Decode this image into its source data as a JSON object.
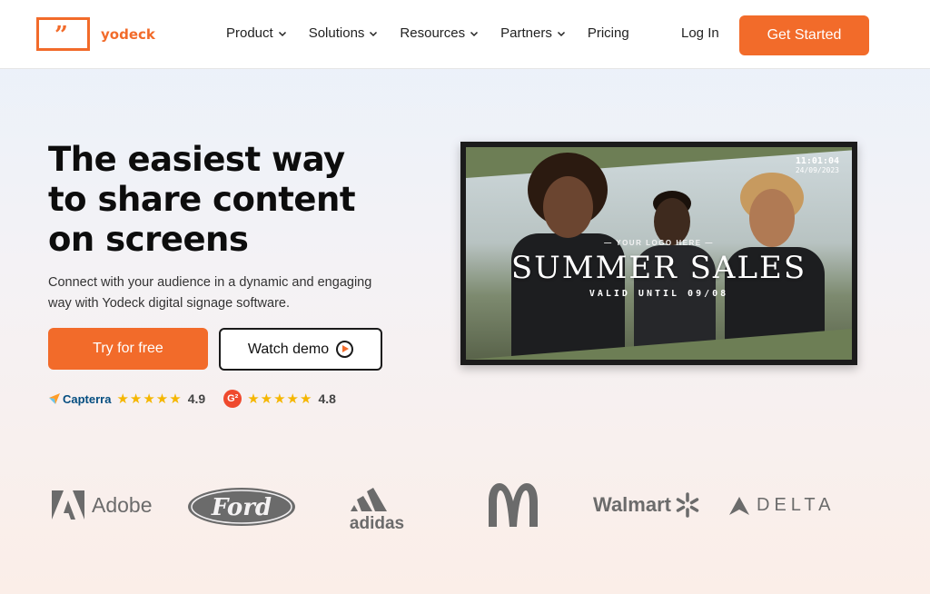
{
  "nav": {
    "logo_text": "yodeck",
    "items": [
      {
        "label": "Product",
        "has_dropdown": true
      },
      {
        "label": "Solutions",
        "has_dropdown": true
      },
      {
        "label": "Resources",
        "has_dropdown": true
      },
      {
        "label": "Partners",
        "has_dropdown": true
      },
      {
        "label": "Pricing",
        "has_dropdown": false
      }
    ],
    "login_label": "Log In",
    "cta_label": "Get Started"
  },
  "hero": {
    "title_lines": [
      "The easiest way",
      "to share content",
      "on screens"
    ],
    "subtitle": "Connect with your audience in a dynamic and engaging way with Yodeck digital signage software.",
    "try_label": "Try for free",
    "demo_label": "Watch demo"
  },
  "ratings": [
    {
      "source": "Capterra",
      "stars": 5,
      "score": "4.9"
    },
    {
      "source": "G2",
      "stars": 5,
      "score": "4.8"
    }
  ],
  "screen": {
    "time": "11:01:04",
    "date": "24/09/2023",
    "logo_placeholder": "YOUR LOGO HERE",
    "headline": "SUMMER SALES",
    "validity": "VALID UNTIL 09/08"
  },
  "brands": {
    "adobe": "Adobe",
    "ford": "Ford",
    "adidas": "adidas",
    "walmart": "Walmart",
    "delta": "DELTA"
  },
  "colors": {
    "accent": "#f26b2a",
    "text_dark": "#0d0d0d",
    "brand_gray": "#6b6b6b",
    "star": "#f5b600"
  }
}
